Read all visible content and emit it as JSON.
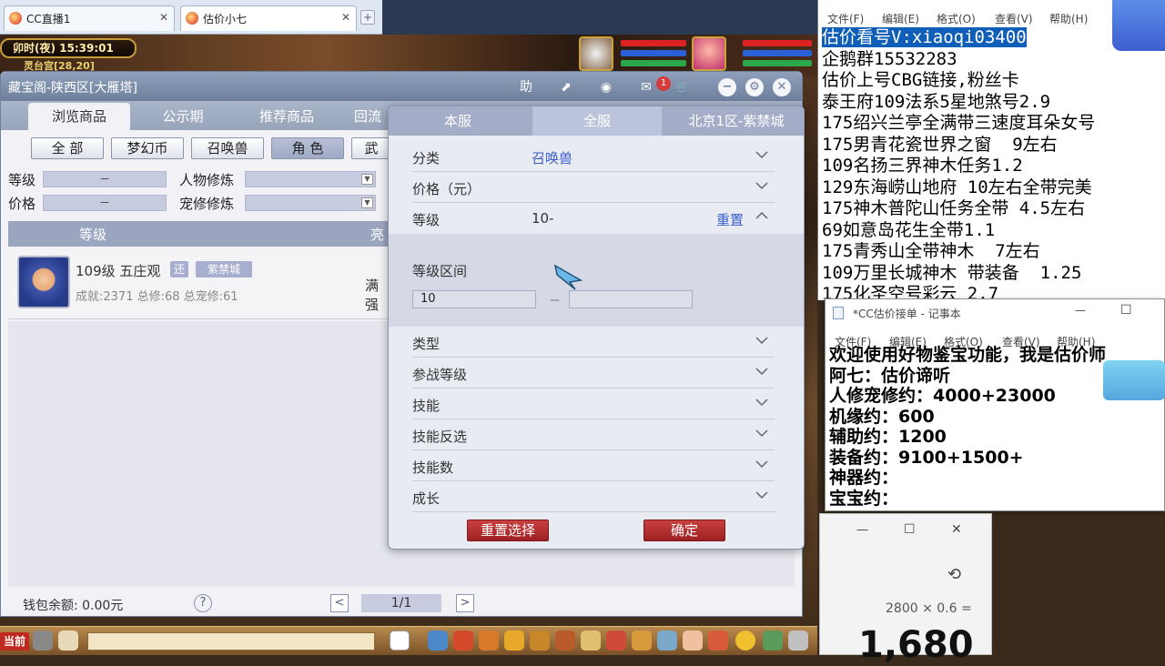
{
  "browser": {
    "tabs": [
      {
        "label": "CC直播1",
        "close": "✕"
      },
      {
        "label": "估价小七",
        "close": "✕"
      }
    ],
    "new_tab": "+"
  },
  "game": {
    "clock": "卯时(夜) 15:39:01",
    "location": "灵台宫[28,20]"
  },
  "window": {
    "title": "藏宝阁-陕西区[大雁塔]",
    "help_label": "助",
    "badge_count": "1",
    "nav_tabs": [
      "浏览商品",
      "公示期",
      "推荐商品",
      "回流"
    ],
    "categories": [
      "全 部",
      "梦幻币",
      "召唤兽",
      "角 色",
      "武"
    ],
    "filters": {
      "level_label": "等级",
      "level_value": "－",
      "price_label": "价格",
      "price_value": "－",
      "char_cultivation_label": "人物修炼",
      "pet_cultivation_label": "宠修修炼"
    },
    "list_header": {
      "level": "等级",
      "col2": "亮"
    },
    "item": {
      "title": "109级 五庄观",
      "tag1": "还",
      "tag2": "紫禁城",
      "stats": "成就:2371 总修:68 总宠修:61",
      "extra": "满强"
    },
    "footer": {
      "wallet": "钱包余额: 0.00元",
      "help": "?",
      "page": "1/1",
      "prev": "<",
      "next": ">"
    }
  },
  "panel": {
    "tabs": [
      "本服",
      "全服",
      "北京1区-紫禁城"
    ],
    "rows": [
      {
        "label": "分类",
        "value": "召唤兽"
      },
      {
        "label": "价格（元）",
        "value": ""
      },
      {
        "label": "等级",
        "value": "10-",
        "action": "重置"
      }
    ],
    "range": {
      "label": "等级区间",
      "min": "10",
      "sep": "－",
      "max": ""
    },
    "rows2": [
      {
        "label": "类型"
      },
      {
        "label": "参战等级"
      },
      {
        "label": "技能"
      },
      {
        "label": "技能反选"
      },
      {
        "label": "技能数"
      },
      {
        "label": "成长"
      }
    ],
    "reset_button": "重置选择",
    "confirm_button": "确定"
  },
  "taskbar": {
    "left_label": "当前"
  },
  "notepad1": {
    "menu": [
      "文件(F)",
      "编辑(E)",
      "格式(O)",
      "查看(V)",
      "帮助(H)"
    ],
    "lines": [
      "估价看号V:xiaoqi03400",
      "企鹅群15532283",
      "估价上号CBG链接,粉丝卡",
      "泰王府109法系5星地煞号2.9",
      "175绍兴兰亭全满带三速度耳朵女号",
      "175男青花瓷世界之窗  9左右",
      "109名扬三界神木任务1.2",
      "129东海崂山地府 10左右全带完美",
      "175神木普陀山任务全带 4.5左右",
      "69如意岛花生全带1.1",
      "175青秀山全带神木  7左右",
      "109万里长城神木 带装备  1.25",
      "175化圣空号彩云 2.7"
    ]
  },
  "notepad2": {
    "title": "*CC估价接单 - 记事本",
    "menu": [
      "文件(F)",
      "编辑(E)",
      "格式(O)",
      "查看(V)",
      "帮助(H)"
    ],
    "minimize": "—",
    "maximize": "☐",
    "lines": [
      "欢迎使用好物鉴宝功能，我是估价师",
      "阿七：估价谛听",
      "人修宠修约：4000+23000",
      "机缘约：600",
      "辅助约：1200",
      "装备约：9100+1500+",
      "神器约：",
      "宝宝约："
    ]
  },
  "calculator": {
    "minimize": "—",
    "maximize": "☐",
    "close": "✕",
    "expression": "2800 × 0.6 =",
    "result": "1,680"
  },
  "colors": {
    "header": "#6d7f9c",
    "accent_blue": "#3a5fc8",
    "red_button": "#b22a2a",
    "highlight": "#0f5eb8"
  }
}
